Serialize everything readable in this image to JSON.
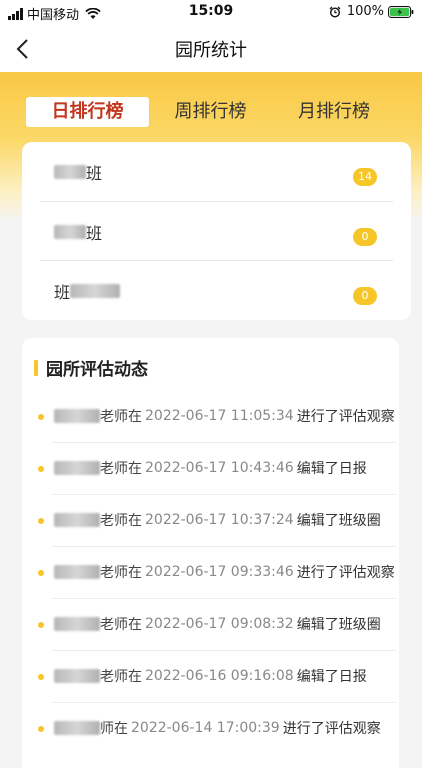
{
  "status_bar": {
    "carrier": "中国移动",
    "time": "15:09",
    "battery": "100%"
  },
  "nav": {
    "title": "园所统计"
  },
  "tabs": [
    {
      "label": "日排行榜",
      "active": true
    },
    {
      "label": "周排行榜",
      "active": false
    },
    {
      "label": "月排行榜",
      "active": false
    }
  ],
  "ranking": [
    {
      "suffix": "班",
      "count": "14"
    },
    {
      "suffix": "班",
      "count": "0"
    },
    {
      "prefix": "班",
      "count": "0"
    }
  ],
  "eval": {
    "title": "园所评估动态",
    "items": [
      {
        "who": "老师在",
        "time": "2022-06-17 11:05:34",
        "action": "进行了评估观察"
      },
      {
        "who": "老师在",
        "time": "2022-06-17 10:43:46",
        "action": "编辑了日报"
      },
      {
        "who": "老师在",
        "time": "2022-06-17 10:37:24",
        "action": "编辑了班级圈"
      },
      {
        "who": "老师在",
        "time": "2022-06-17 09:33:46",
        "action": "进行了评估观察"
      },
      {
        "who": "老师在",
        "time": "2022-06-17 09:08:32",
        "action": "编辑了班级圈"
      },
      {
        "who": "老师在",
        "time": "2022-06-16 09:16:08",
        "action": "编辑了日报"
      },
      {
        "who": "师在",
        "time": "2022-06-14 17:00:39",
        "action": "进行了评估观察"
      }
    ]
  },
  "colors": {
    "accent": "#f6c527",
    "active_tab_text": "#c2361e"
  }
}
